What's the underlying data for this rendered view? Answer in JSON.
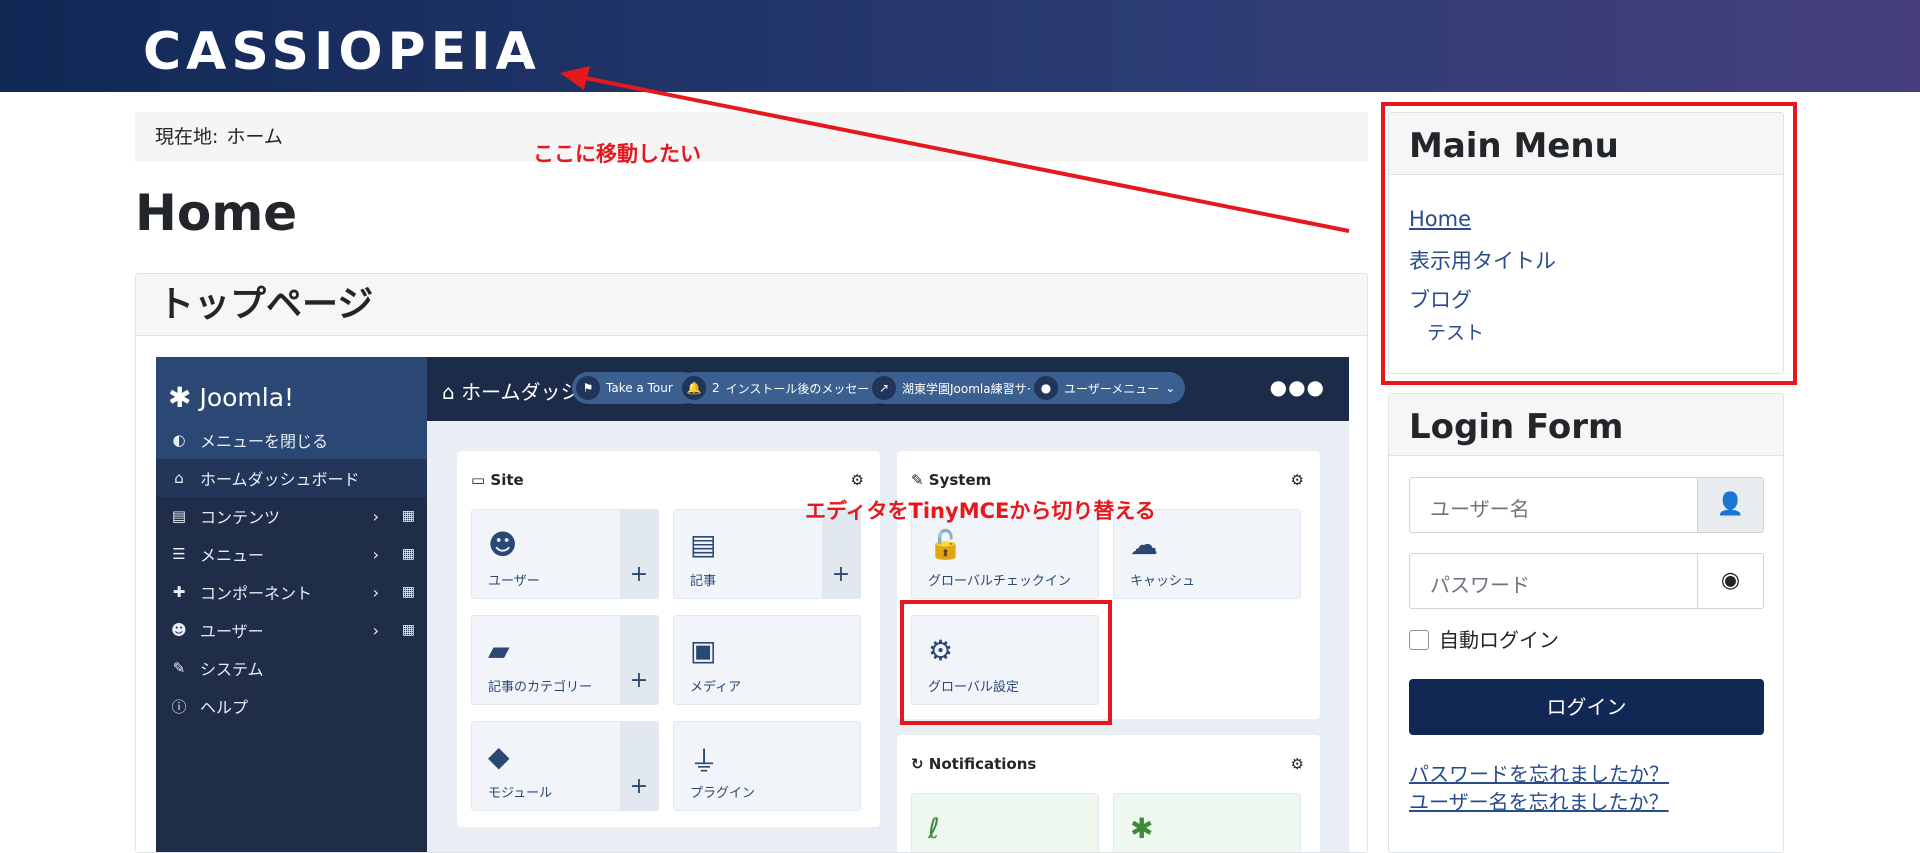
{
  "site": {
    "brand": "CASSIOPEIA"
  },
  "breadcrumb": {
    "label": "現在地:",
    "item": "ホーム"
  },
  "annotations": {
    "move_here": "ここに移動したい",
    "editor_switch": "エディタをTinyMCEから切り替える",
    "color": "#e5181d"
  },
  "page": {
    "title": "Home"
  },
  "article": {
    "title": "トップページ"
  },
  "joomla": {
    "logo": "Joomla!",
    "menu": [
      {
        "label": "メニューを閉じる",
        "icon": "toggle-icon"
      },
      {
        "label": "ホームダッシュボード",
        "icon": "home-icon"
      },
      {
        "label": "コンテンツ",
        "icon": "file-icon"
      },
      {
        "label": "メニュー",
        "icon": "list-icon"
      },
      {
        "label": "コンポーネント",
        "icon": "puzzle-icon"
      },
      {
        "label": "ユーザー",
        "icon": "users-icon"
      },
      {
        "label": "システム",
        "icon": "wrench-icon"
      },
      {
        "label": "ヘルプ",
        "icon": "info-icon"
      }
    ],
    "topbar": {
      "title": "ホームダッシ",
      "tour": "Take a Tour",
      "messages_count": "2",
      "messages": "インストール後のメッセージ",
      "site": "湖東学園Joomla練習サイト",
      "user_menu": "ユーザーメニュー"
    },
    "site_panel": {
      "title": "Site",
      "tiles": [
        "ユーザー",
        "記事",
        "記事のカテゴリー",
        "メディア",
        "モジュール",
        "プラグイン"
      ]
    },
    "system_panel": {
      "title": "System",
      "tiles": [
        "グローバルチェックイン",
        "キャッシュ",
        "グローバル設定"
      ]
    },
    "notifications_panel": {
      "title": "Notifications"
    }
  },
  "main_menu": {
    "title": "Main Menu",
    "items": [
      "Home",
      "表示用タイトル",
      "ブログ",
      "テスト"
    ]
  },
  "login": {
    "title": "Login Form",
    "username_placeholder": "ユーザー名",
    "password_placeholder": "パスワード",
    "remember": "自動ログイン",
    "submit": "ログイン",
    "forgot_password": "パスワードを忘れましたか？",
    "forgot_username": "ユーザー名を忘れましたか？"
  }
}
